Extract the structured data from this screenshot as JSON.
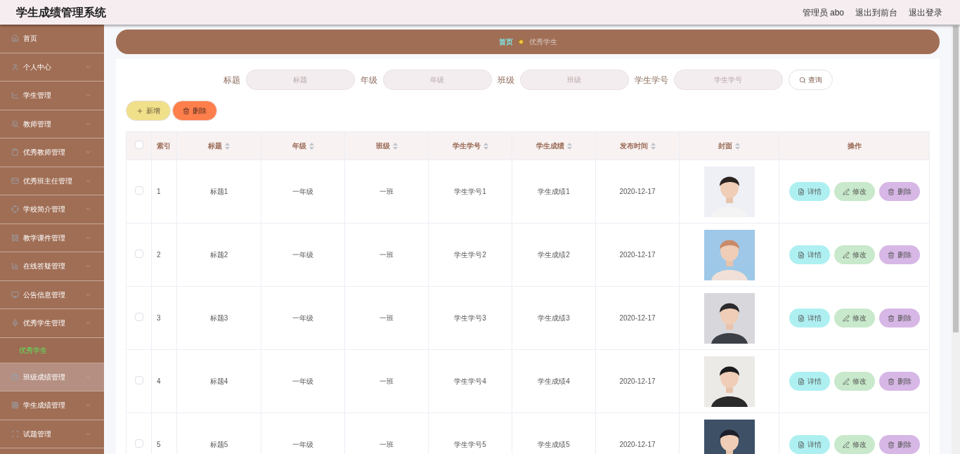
{
  "header": {
    "title": "学生成绩管理系统",
    "links": [
      "管理员 abo",
      "退出到前台",
      "退出登录"
    ]
  },
  "sidebar": {
    "items": [
      {
        "label": "首页",
        "expandable": false,
        "selected": false
      },
      {
        "label": "个人中心",
        "expandable": true,
        "expanded": false,
        "selected": false
      },
      {
        "label": "学生管理",
        "expandable": true,
        "expanded": false,
        "selected": false
      },
      {
        "label": "教师管理",
        "expandable": true,
        "expanded": false,
        "selected": false
      },
      {
        "label": "优秀教师管理",
        "expandable": true,
        "expanded": false,
        "selected": false
      },
      {
        "label": "优秀班主任管理",
        "expandable": true,
        "expanded": false,
        "selected": false
      },
      {
        "label": "学校简介管理",
        "expandable": true,
        "expanded": false,
        "selected": false
      },
      {
        "label": "教学课件管理",
        "expandable": true,
        "expanded": false,
        "selected": false
      },
      {
        "label": "在线答疑管理",
        "expandable": true,
        "expanded": false,
        "selected": false
      },
      {
        "label": "公告信息管理",
        "expandable": true,
        "expanded": false,
        "selected": false
      },
      {
        "label": "优秀学生管理",
        "expandable": true,
        "expanded": true,
        "selected": false,
        "children": [
          {
            "label": "优秀学生",
            "selected": true
          }
        ]
      },
      {
        "label": "班级成绩管理",
        "expandable": true,
        "expanded": false,
        "selected": true
      },
      {
        "label": "学生成绩管理",
        "expandable": true,
        "expanded": false,
        "selected": false
      },
      {
        "label": "试题管理",
        "expandable": true,
        "expanded": false,
        "selected": false
      }
    ]
  },
  "breadcrumb": [
    "首页",
    "优秀学生"
  ],
  "search": {
    "fields": [
      {
        "label": "标题",
        "placeholder": "标题"
      },
      {
        "label": "年级",
        "placeholder": "年级"
      },
      {
        "label": "班级",
        "placeholder": "班级"
      },
      {
        "label": "学生学号",
        "placeholder": "学生学号"
      }
    ],
    "button": "查询"
  },
  "actions": [
    {
      "kind": "add",
      "label": "新增"
    },
    {
      "kind": "delete",
      "label": "删除"
    }
  ],
  "table": {
    "select_all": {
      "checked": false
    },
    "columns": [
      {
        "label": "索引",
        "sortable": false
      },
      {
        "label": "标题",
        "sortable": true
      },
      {
        "label": "年级",
        "sortable": true
      },
      {
        "label": "班级",
        "sortable": true
      },
      {
        "label": "学生学号",
        "sortable": true
      },
      {
        "label": "学生成绩",
        "sortable": true
      },
      {
        "label": "发布时间",
        "sortable": true
      },
      {
        "label": "封面",
        "sortable": true
      },
      {
        "label": "操作",
        "sortable": false
      }
    ],
    "rows": [
      {
        "checked": false,
        "cells": [
          "1",
          "标题1",
          "一年级",
          "一班",
          "学生学号1",
          "学生成绩1",
          "2020-12-17"
        ],
        "cover": {
          "kind": "picture"
        },
        "actions": [
          {
            "kind": "detail",
            "label": "详情"
          },
          {
            "kind": "edit",
            "label": "修改"
          },
          {
            "kind": "delete",
            "label": "删除"
          }
        ]
      },
      {
        "checked": false,
        "cells": [
          "2",
          "标题2",
          "一年级",
          "一班",
          "学生学号2",
          "学生成绩2",
          "2020-12-17"
        ],
        "cover": {
          "kind": "picture"
        },
        "actions": [
          {
            "kind": "detail",
            "label": "详情"
          },
          {
            "kind": "edit",
            "label": "修改"
          },
          {
            "kind": "delete",
            "label": "删除"
          }
        ]
      },
      {
        "checked": false,
        "cells": [
          "3",
          "标题3",
          "一年级",
          "一班",
          "学生学号3",
          "学生成绩3",
          "2020-12-17"
        ],
        "cover": {
          "kind": "picture"
        },
        "actions": [
          {
            "kind": "detail",
            "label": "详情"
          },
          {
            "kind": "edit",
            "label": "修改"
          },
          {
            "kind": "delete",
            "label": "删除"
          }
        ]
      },
      {
        "checked": false,
        "cells": [
          "4",
          "标题4",
          "一年级",
          "一班",
          "学生学号4",
          "学生成绩4",
          "2020-12-17"
        ],
        "cover": {
          "kind": "picture"
        },
        "actions": [
          {
            "kind": "detail",
            "label": "详情"
          },
          {
            "kind": "edit",
            "label": "修改"
          },
          {
            "kind": "delete",
            "label": "删除"
          }
        ]
      },
      {
        "checked": false,
        "cells": [
          "5",
          "标题5",
          "一年级",
          "一班",
          "学生学号5",
          "学生成绩5",
          "2020-12-17"
        ],
        "cover": {
          "kind": "picture"
        },
        "actions": [
          {
            "kind": "detail",
            "label": "详情"
          },
          {
            "kind": "edit",
            "label": "修改"
          },
          {
            "kind": "delete",
            "label": "删除"
          }
        ]
      }
    ]
  }
}
